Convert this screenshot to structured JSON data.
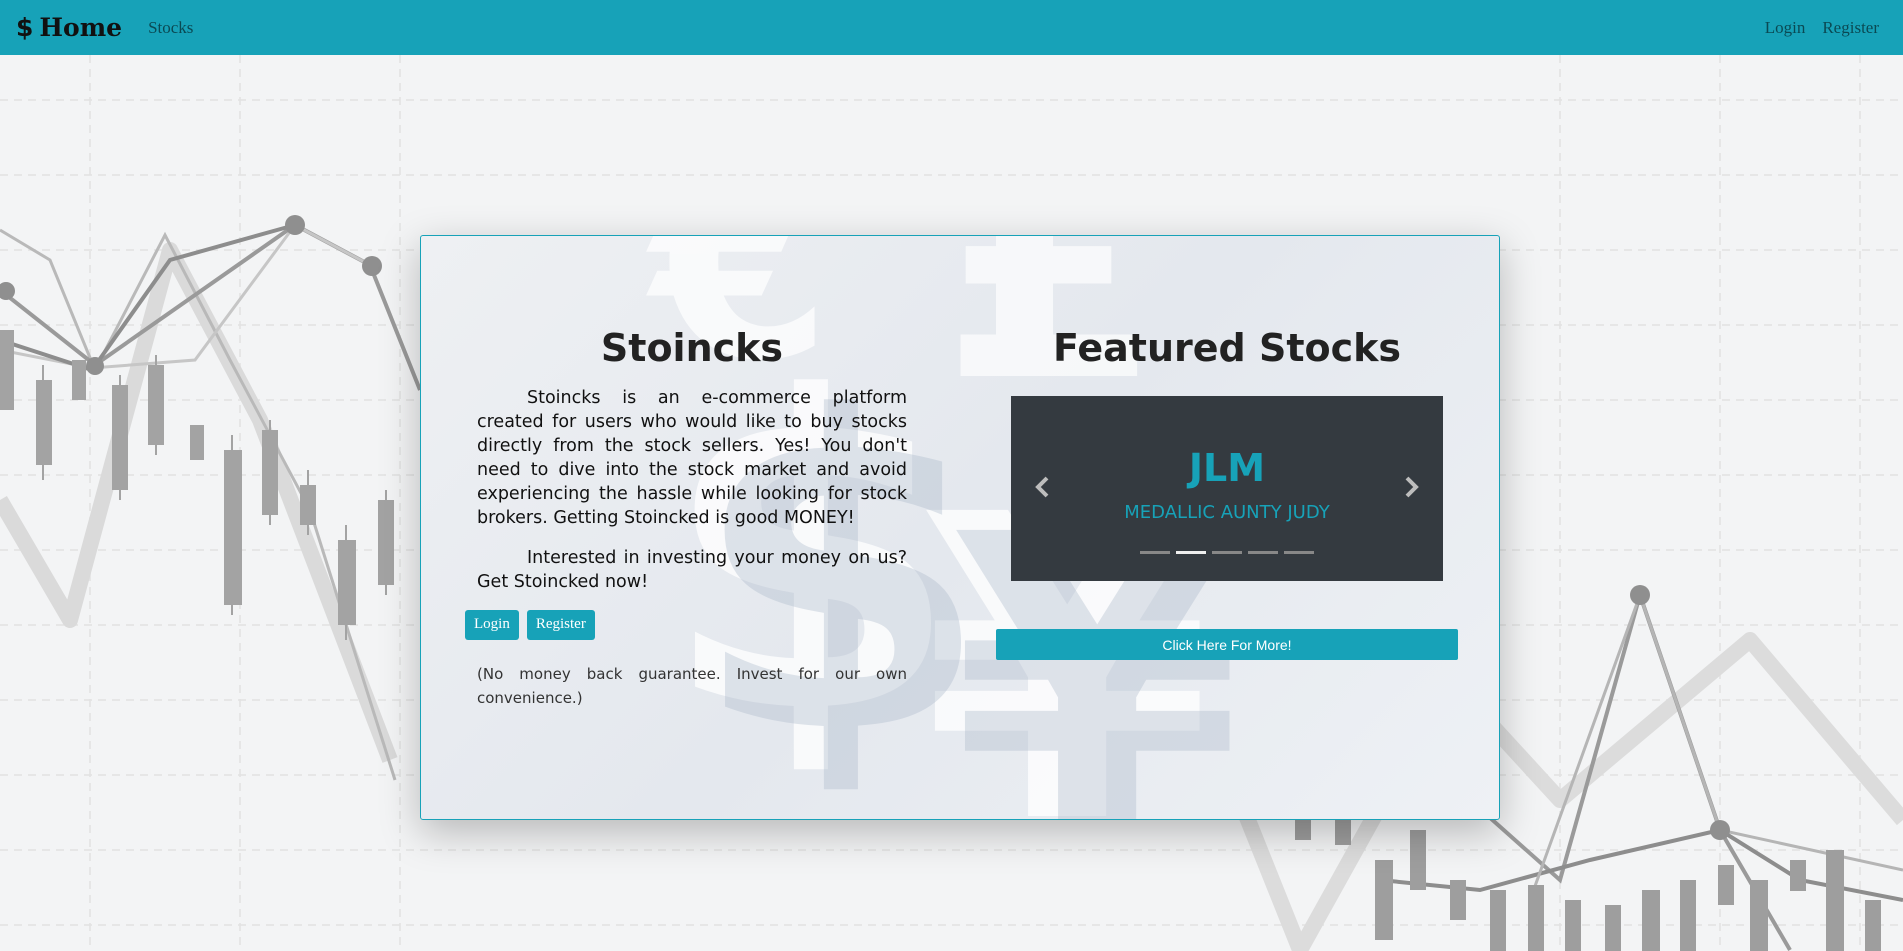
{
  "navbar": {
    "brand_icon": "dollar-sign-icon",
    "brand_symbol": "$",
    "brand_label": "Home",
    "stocks_link": "Stocks",
    "login_link": "Login",
    "register_link": "Register",
    "color": "#17a2b8"
  },
  "intro": {
    "title": "Stoincks",
    "paragraph1": "Stoincks is an e-commerce platform created for users who would like to buy stocks directly from the stock sellers. Yes! You don't need to dive into the stock market and avoid experiencing the hassle while looking for stock brokers. Getting Stoincked is good MONEY!",
    "paragraph2": "Interested in investing your money on us? Get Stoincked now!",
    "login_button": "Login",
    "register_button": "Register",
    "note": "(No money back guarantee. Invest for our own convenience.)"
  },
  "featured": {
    "title": "Featured Stocks",
    "carousel": {
      "ticker": "JLM",
      "company": "MEDALLIC AUNTY JUDY",
      "prev_icon": "chevron-left-icon",
      "next_icon": "chevron-right-icon",
      "slide_count": 5,
      "active_slide": 2
    },
    "more_button": "Click Here For More!"
  }
}
